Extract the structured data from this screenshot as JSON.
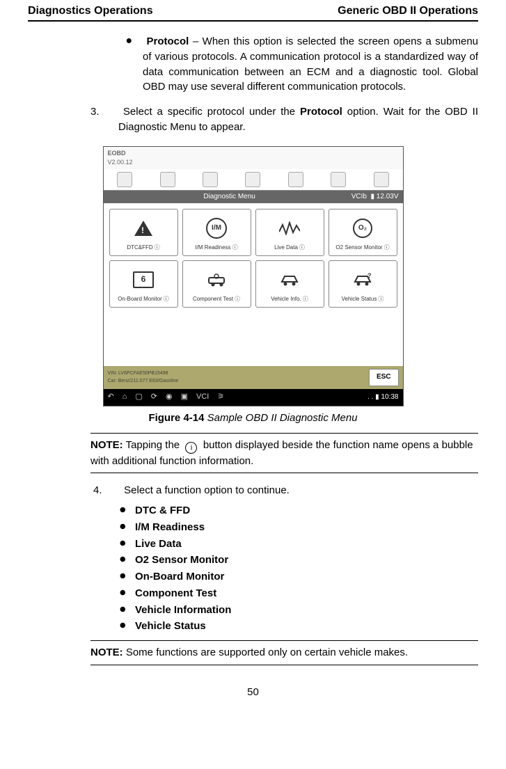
{
  "header": {
    "left": "Diagnostics Operations",
    "right": "Generic OBD II Operations"
  },
  "protocol_bullet": {
    "term": "Protocol",
    "desc": " – When this option is selected the screen opens a submenu of various protocols. A communication protocol is a standardized way of data communication between an ECM and a diagnostic tool. Global OBD may use several different communication protocols."
  },
  "step3": {
    "num": "3.",
    "text_before": "Select a specific protocol under the ",
    "bold": "Protocol",
    "text_after": " option. Wait for the OBD II Diagnostic Menu to appear."
  },
  "figure": {
    "eobd_label": "EOBD",
    "version": "V2.00.12",
    "diag_menu_title": "Diagnostic Menu",
    "vci_label": "VCIb",
    "voltage": "12.03V",
    "tiles": [
      {
        "label": "DTC&FFD",
        "info": "ⓘ"
      },
      {
        "label": "I/M Readiness",
        "info": "ⓘ"
      },
      {
        "label": "Live Data",
        "info": "ⓘ"
      },
      {
        "label": "O2 Sensor Monitor",
        "info": "ⓘ"
      },
      {
        "label": "On-Board Monitor",
        "info": "ⓘ"
      },
      {
        "label": "Component Test",
        "info": "ⓘ"
      },
      {
        "label": "Vehicle Info.",
        "info": "ⓘ"
      },
      {
        "label": "Vehicle Status",
        "info": "ⓘ"
      }
    ],
    "vin_line1": "VIN: LV6PCFAE50PB15498",
    "vin_line2": "Car: Benz/211.077 E63/Gasoline",
    "esc": "ESC",
    "time": "10:38"
  },
  "caption": {
    "label": "Figure 4-14",
    "text": " Sample OBD II Diagnostic Menu"
  },
  "note1": {
    "label": "NOTE:",
    "before": " Tapping the ",
    "after": " button displayed beside the function name opens a bubble with additional function information."
  },
  "step4": {
    "num": "4.",
    "text": "Select a function option to continue."
  },
  "functions": [
    "DTC & FFD",
    "I/M Readiness",
    "Live Data",
    "O2 Sensor Monitor",
    "On-Board Monitor",
    "Component Test",
    "Vehicle Information",
    "Vehicle Status"
  ],
  "note2": {
    "label": "NOTE:",
    "text": " Some functions are supported only on certain vehicle makes."
  },
  "page_number": "50"
}
